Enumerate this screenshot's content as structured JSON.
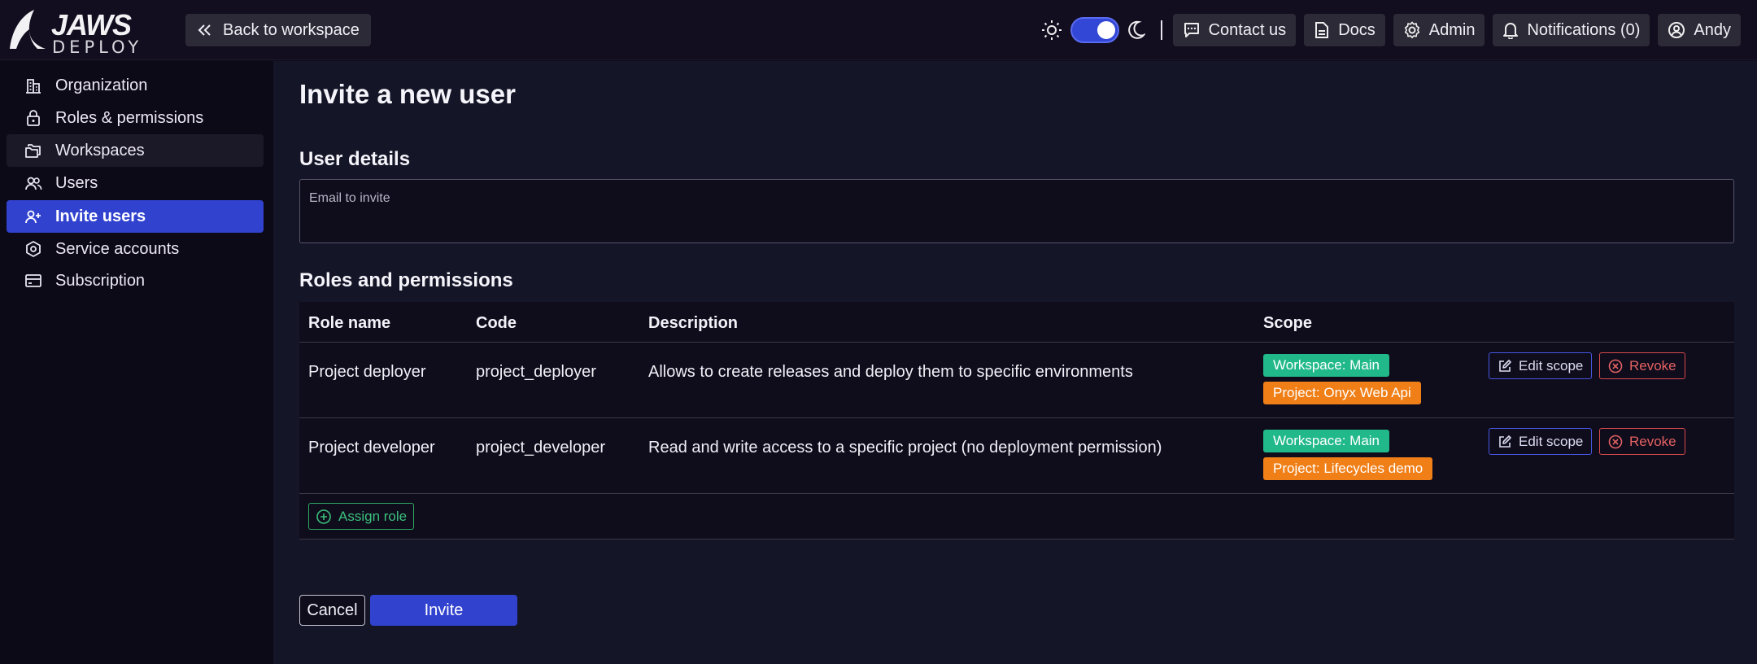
{
  "header": {
    "logo_text": "JAWS",
    "logo_subtext": "DEPLOY",
    "back_label": "Back to workspace",
    "actions": {
      "contact": "Contact us",
      "docs": "Docs",
      "admin": "Admin",
      "notifications": "Notifications (0)",
      "user": "Andy"
    },
    "theme_dark_mode": true
  },
  "sidebar": {
    "items": [
      {
        "label": "Organization",
        "icon": "building-icon"
      },
      {
        "label": "Roles & permissions",
        "icon": "lock-icon"
      },
      {
        "label": "Workspaces",
        "icon": "folders-icon"
      },
      {
        "label": "Users",
        "icon": "users-icon"
      },
      {
        "label": "Invite users",
        "icon": "user-plus-icon",
        "active": true
      },
      {
        "label": "Service accounts",
        "icon": "hexagon-icon"
      },
      {
        "label": "Subscription",
        "icon": "credit-card-icon"
      }
    ]
  },
  "main": {
    "title": "Invite a new user",
    "user_details_title": "User details",
    "email_label": "Email to invite",
    "email_value": "",
    "roles_title": "Roles and permissions",
    "table": {
      "headers": {
        "role": "Role name",
        "code": "Code",
        "description": "Description",
        "scope": "Scope"
      },
      "rows": [
        {
          "role": "Project deployer",
          "code": "project_deployer",
          "description": "Allows to create releases and deploy them to specific environments",
          "scope_workspace": "Workspace: Main",
          "scope_project": "Project: Onyx Web Api"
        },
        {
          "role": "Project developer",
          "code": "project_developer",
          "description": "Read and write access to a specific project (no deployment permission)",
          "scope_workspace": "Workspace: Main",
          "scope_project": "Project: Lifecycles demo"
        }
      ],
      "edit_scope_label": "Edit scope",
      "revoke_label": "Revoke",
      "assign_role_label": "Assign role"
    },
    "cancel_label": "Cancel",
    "invite_label": "Invite"
  },
  "colors": {
    "accent": "#3142cf",
    "scope_workspace": "#22b98a",
    "scope_project": "#f07f17",
    "revoke": "#e46262",
    "assign": "#3bc17c"
  }
}
